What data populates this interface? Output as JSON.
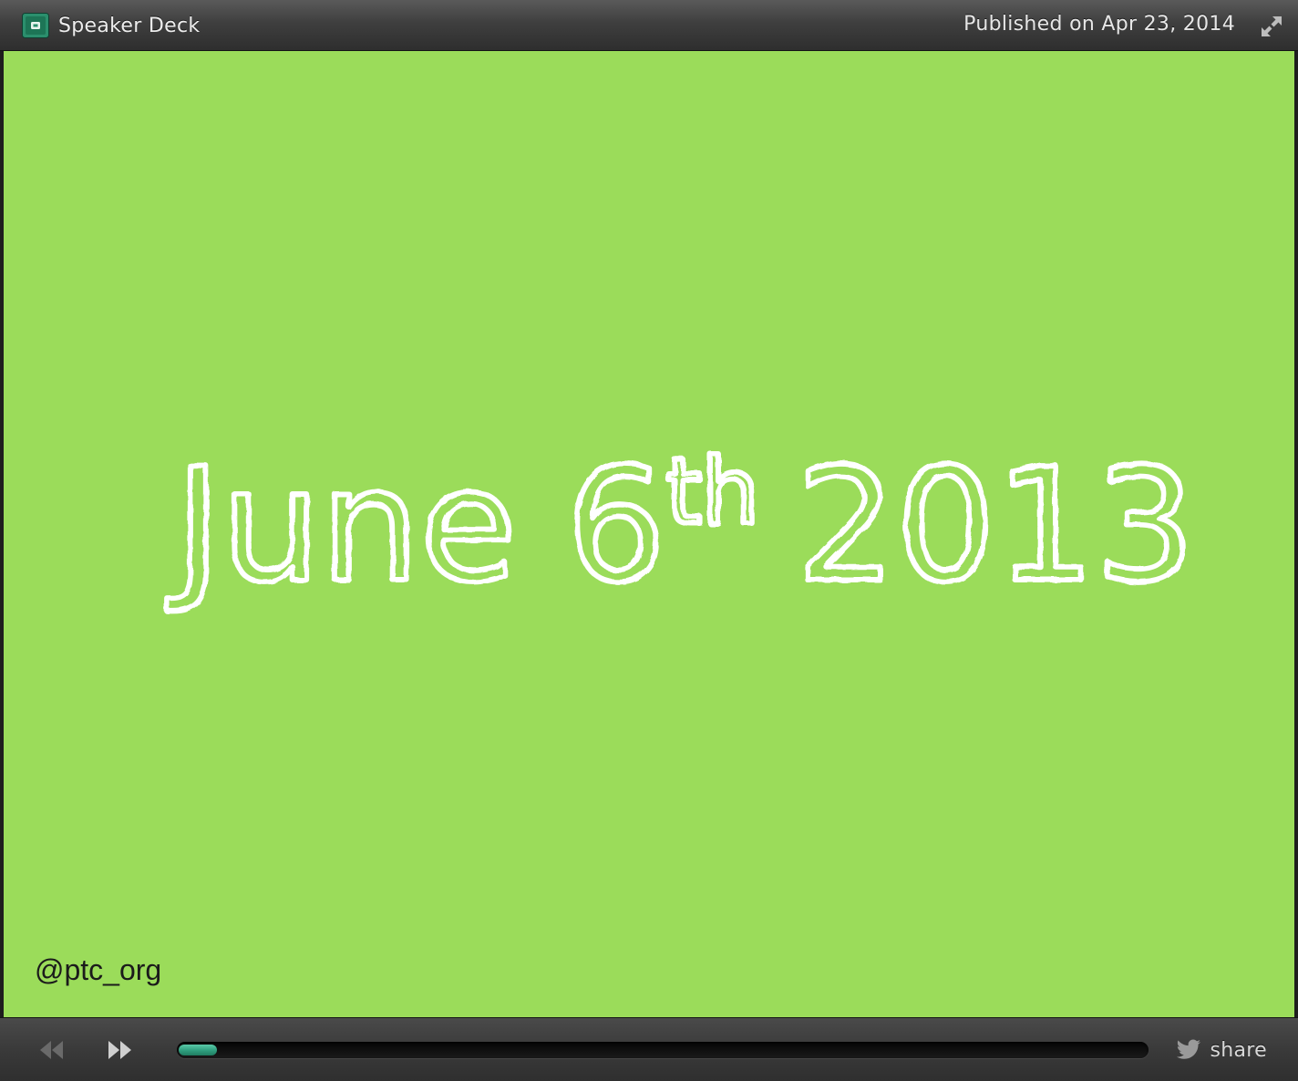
{
  "header": {
    "brand": "Speaker Deck",
    "published": "Published on Apr 23, 2014"
  },
  "slide": {
    "title_main": "June 6",
    "title_sup": "th",
    "title_year": "2013",
    "handle": "@ptc_org",
    "background_color": "#9bdc5a"
  },
  "controls": {
    "share_label": "share",
    "progress_fraction": 0.04
  },
  "icons": {
    "logo": "speaker-deck-logo-icon",
    "fullscreen": "expand-arrows-icon",
    "prev": "rewind-icon",
    "next": "fast-forward-icon",
    "share": "twitter-bird-icon"
  },
  "colors": {
    "accent": "#2f9e7e",
    "slide_text": "#ffffff"
  }
}
